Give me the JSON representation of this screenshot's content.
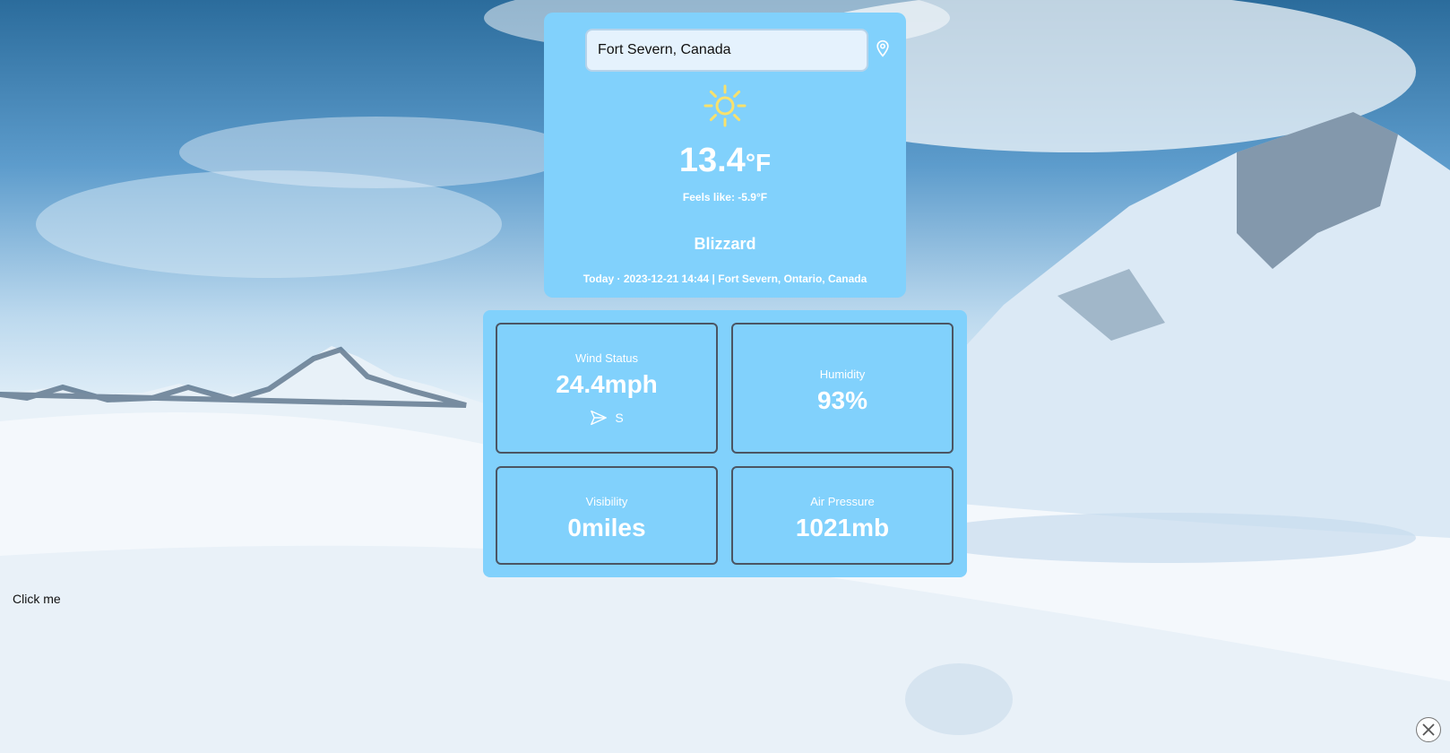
{
  "search": {
    "value": "Fort Severn, Canada"
  },
  "current": {
    "weather_icon": "sun-icon",
    "temperature": "13.4",
    "unit": "°F",
    "feels_like": "Feels like: -5.9°F",
    "condition": "Blizzard",
    "footer": "Today · 2023-12-21 14:44 | Fort Severn, Ontario, Canada"
  },
  "tiles": {
    "wind": {
      "label": "Wind Status",
      "value": "24.4mph",
      "direction": "S"
    },
    "humidity": {
      "label": "Humidity",
      "value": "93%"
    },
    "visibility": {
      "label": "Visibility",
      "value": "0miles"
    },
    "pressure": {
      "label": "Air Pressure",
      "value": "1021mb"
    }
  },
  "click_me": "Click me",
  "colors": {
    "card": "#81d1fc",
    "sun": "#f8e16c",
    "tile_border": "#4b5563"
  }
}
